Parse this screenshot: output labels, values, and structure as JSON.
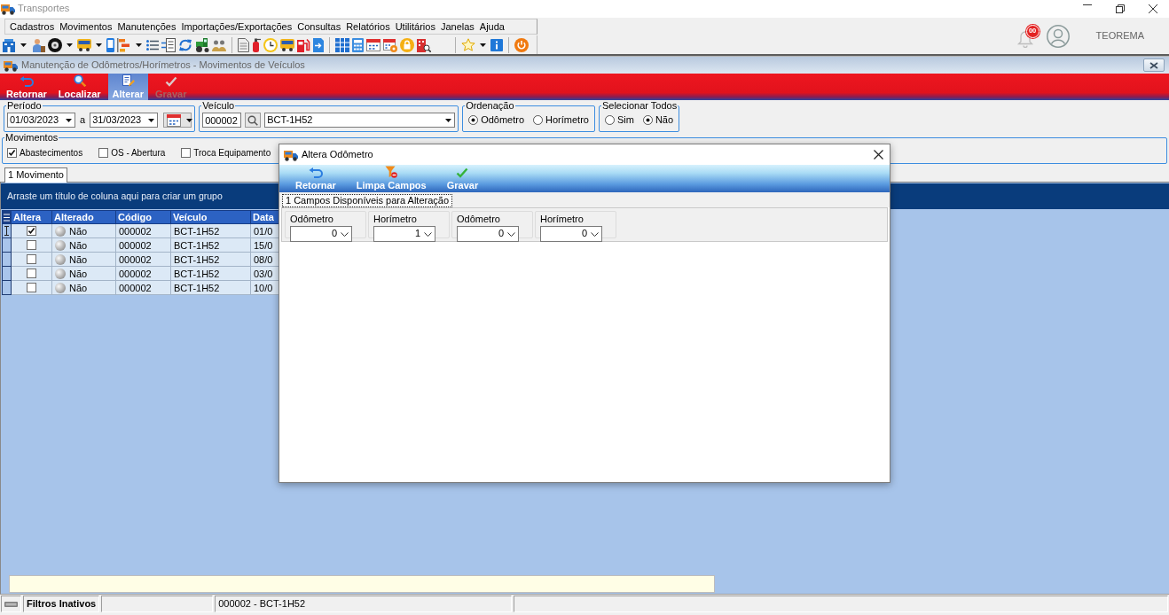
{
  "window": {
    "title": "Transportes"
  },
  "menu": [
    "Cadastros",
    "Movimentos",
    "Manutenções",
    "Importações/Exportações",
    "Consultas",
    "Relatórios",
    "Utilitários",
    "Janelas",
    "Ajuda"
  ],
  "notifications": {
    "badge": "00"
  },
  "user": {
    "name": "TEOREMA"
  },
  "child_window": {
    "title": "Manutenção de Odômetros/Horímetros - Movimentos de Veículos"
  },
  "toolbar": [
    {
      "label": "Retornar",
      "kind": "back",
      "selected": false,
      "disabled": false
    },
    {
      "label": "Localizar",
      "kind": "search",
      "selected": false,
      "disabled": false
    },
    {
      "label": "Alterar",
      "kind": "edit",
      "selected": true,
      "disabled": false
    },
    {
      "label": "Gravar",
      "kind": "save",
      "selected": false,
      "disabled": true
    }
  ],
  "filters": {
    "period": {
      "label": "Período",
      "from": "01/03/2023",
      "separator": "a",
      "to": "31/03/2023"
    },
    "vehicle": {
      "label": "Veículo",
      "code": "000002",
      "name": "BCT-1H52"
    },
    "ordering": {
      "label": "Ordenação",
      "options": [
        {
          "label": "Odômetro",
          "selected": true
        },
        {
          "label": "Horímetro",
          "selected": false
        }
      ]
    },
    "select_all": {
      "label": "Selecionar Todos",
      "options": [
        {
          "label": "Sim",
          "selected": false
        },
        {
          "label": "Não",
          "selected": true
        }
      ]
    }
  },
  "movements": {
    "label": "Movimentos",
    "options": [
      {
        "label": "Abastecimentos",
        "checked": true
      },
      {
        "label": "OS - Abertura",
        "checked": false
      },
      {
        "label": "Troca Equipamento",
        "checked": false
      }
    ]
  },
  "tabs": [
    {
      "label": "1 Movimento",
      "selected": true
    }
  ],
  "grid": {
    "group_hint": "Arraste um título de coluna aqui para criar um grupo",
    "columns": [
      "Altera",
      "Alterado",
      "Código",
      "Veículo",
      "Data"
    ],
    "rows": [
      {
        "current": true,
        "cells": [
          {
            "kind": "checkbox",
            "checked": true
          },
          {
            "kind": "status",
            "text": "Não"
          },
          {
            "kind": "text",
            "text": "000002"
          },
          {
            "kind": "text",
            "text": "BCT-1H52"
          },
          {
            "kind": "text",
            "text": "01/0"
          }
        ]
      },
      {
        "current": false,
        "cells": [
          {
            "kind": "checkbox",
            "checked": false
          },
          {
            "kind": "status",
            "text": "Não"
          },
          {
            "kind": "text",
            "text": "000002"
          },
          {
            "kind": "text",
            "text": "BCT-1H52"
          },
          {
            "kind": "text",
            "text": "15/0"
          }
        ]
      },
      {
        "current": false,
        "cells": [
          {
            "kind": "checkbox",
            "checked": false
          },
          {
            "kind": "status",
            "text": "Não"
          },
          {
            "kind": "text",
            "text": "000002"
          },
          {
            "kind": "text",
            "text": "BCT-1H52"
          },
          {
            "kind": "text",
            "text": "08/0"
          }
        ]
      },
      {
        "current": false,
        "cells": [
          {
            "kind": "checkbox",
            "checked": false
          },
          {
            "kind": "status",
            "text": "Não"
          },
          {
            "kind": "text",
            "text": "000002"
          },
          {
            "kind": "text",
            "text": "BCT-1H52"
          },
          {
            "kind": "text",
            "text": "03/0"
          }
        ]
      },
      {
        "current": false,
        "cells": [
          {
            "kind": "checkbox",
            "checked": false
          },
          {
            "kind": "status",
            "text": "Não"
          },
          {
            "kind": "text",
            "text": "000002"
          },
          {
            "kind": "text",
            "text": "BCT-1H52"
          },
          {
            "kind": "text",
            "text": "10/0"
          }
        ]
      }
    ]
  },
  "status_bar": {
    "filters": "Filtros Inativos",
    "vehicle": "000002 - BCT-1H52"
  },
  "dialog": {
    "title": "Altera Odômetro",
    "toolbar": [
      {
        "label": "Retornar",
        "kind": "back"
      },
      {
        "label": "Limpa Campos",
        "kind": "clear"
      },
      {
        "label": "Gravar",
        "kind": "save"
      }
    ],
    "tabs": [
      {
        "label": "1 Campos Disponíveis para Alteração",
        "selected": true
      }
    ],
    "fields": [
      {
        "label": "Odômetro",
        "value": "0"
      },
      {
        "label": "Horímetro",
        "value": "1"
      },
      {
        "label": "Odômetro",
        "value": "0"
      },
      {
        "label": "Horímetro",
        "value": "0"
      }
    ]
  }
}
